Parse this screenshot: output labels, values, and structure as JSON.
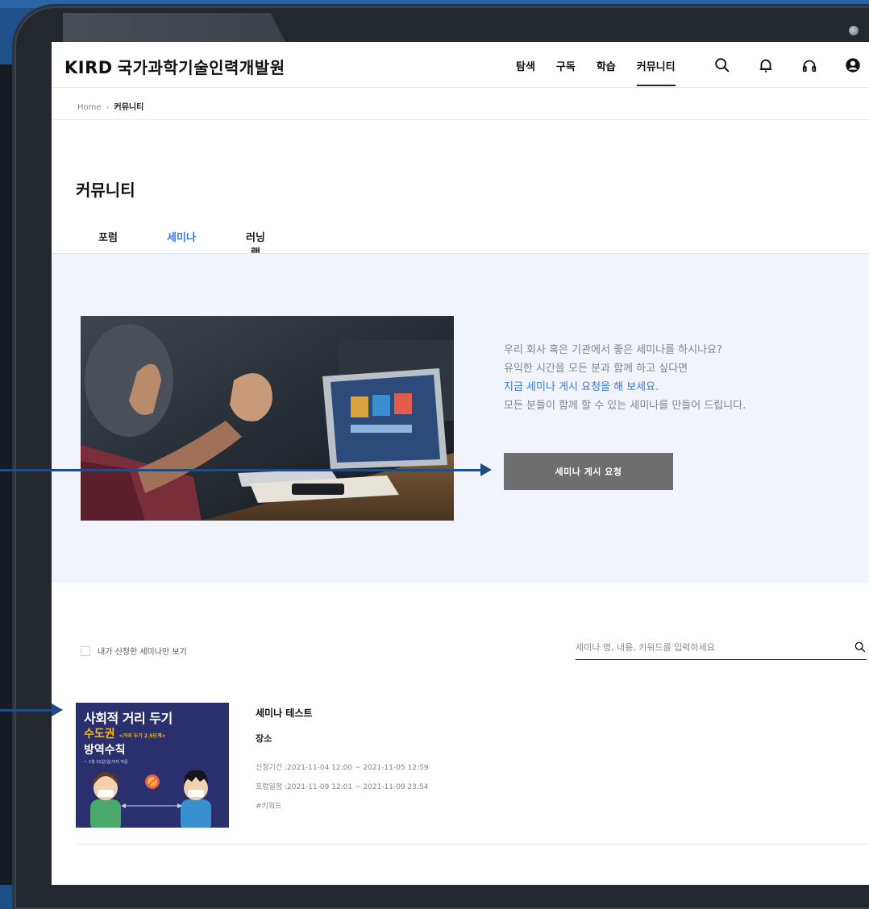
{
  "header": {
    "logo_brand": "KIRD",
    "logo_name": "국가과학기술인력개발원",
    "nav": [
      "탐색",
      "구독",
      "학습",
      "커뮤니티"
    ],
    "active_nav_index": 3,
    "icons": [
      "search-icon",
      "bell-icon",
      "headphones-icon",
      "user-icon"
    ]
  },
  "breadcrumb": {
    "home": "Home",
    "current": "커뮤니티"
  },
  "page": {
    "title": "커뮤니티"
  },
  "tabs": [
    {
      "label": "포럼",
      "active": false
    },
    {
      "label": "세미나",
      "active": true
    },
    {
      "label": "러닝랩",
      "active": false
    }
  ],
  "banner": {
    "line1": "우리 회사 혹은 기관에서 좋은 세미나를 하시나요?",
    "line2": "유익한 시간을 모든 분과 함께 하고 싶다면",
    "line3": "지금 세미나 게시 요청을 해 보세요.",
    "line4": "모든 분들이 함께 할 수 있는 세미나를 만들어 드립니다.",
    "button": "세미나 게시 요청"
  },
  "filter": {
    "checkbox_label": "내가 신청한 세미나만 보기",
    "checked": false,
    "search_placeholder": "세미나 명, 내용, 키워드를 입력하세요",
    "search_value": ""
  },
  "seminars": [
    {
      "thumb_line1": "사회적 거리 두기",
      "thumb_line2": "수도권",
      "thumb_line2_small": "<거리 두기 2.5단계>",
      "thumb_line3": "방역수칙",
      "thumb_line4": "~ 1월 31일(일)까지 적용",
      "title": "세미나 테스트",
      "place": "장소",
      "apply_period": "신청기간 :2021-11-04 12:00 ~ 2021-11-05 12:59",
      "forum_period": "포럼일정 :2021-11-09 12:01 ~ 2021-11-09 23:54",
      "keyword": "#키워드"
    }
  ],
  "colors": {
    "accent": "#3a7bd5",
    "button_bg": "#6e6e6e",
    "banner_bg": "#f1f5fb",
    "arrow": "#1f4c85",
    "thumb_bg": "#2a2f6e",
    "thumb_yellow": "#f6b81c"
  }
}
